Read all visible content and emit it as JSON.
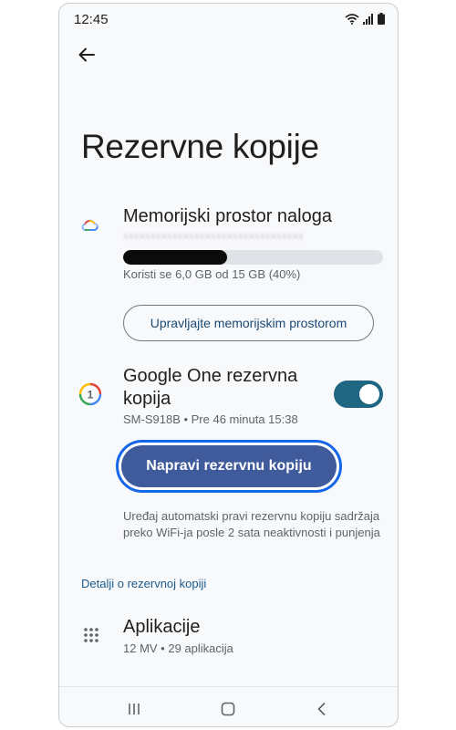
{
  "status_bar": {
    "time": "12:45",
    "icons": [
      "wifi-icon",
      "signal-icon",
      "battery-icon"
    ]
  },
  "header": {
    "back_icon": "arrow-left-icon",
    "title": "Rezervne kopije"
  },
  "storage": {
    "icon": "cloud-icon",
    "title": "Memorijski prostor naloga",
    "usage_text": "Koristi se 6,0 GB od 15 GB (40%)",
    "usage_fraction": 0.4,
    "manage_label": "Upravljajte memorijskim prostorom"
  },
  "google_one_backup": {
    "icon": "google-one-icon",
    "title": "Google One rezervna kopija",
    "device_info": "SM-S918B • Pre 46 minuta 15:38",
    "enabled": true,
    "backup_button_label": "Napravi rezervnu kopiju",
    "auto_note": "Uređaj automatski pravi rezervnu kopiju sadržaja preko WiFi-ja posle 2 sata neaktivnosti i punjenja"
  },
  "details": {
    "section_label": "Detalji o rezervnoj kopiji",
    "apps": {
      "icon": "apps-grid-icon",
      "title": "Aplikacije",
      "subtitle": "12 MV • 29 aplikacija"
    }
  },
  "navigation_bar": {
    "buttons": [
      "recents-icon",
      "home-icon",
      "back-icon"
    ]
  },
  "colors": {
    "accent": "#1f6683",
    "button_fill": "#3f5b9b",
    "focus_ring": "#1566e8",
    "link": "#1d5a8c"
  }
}
